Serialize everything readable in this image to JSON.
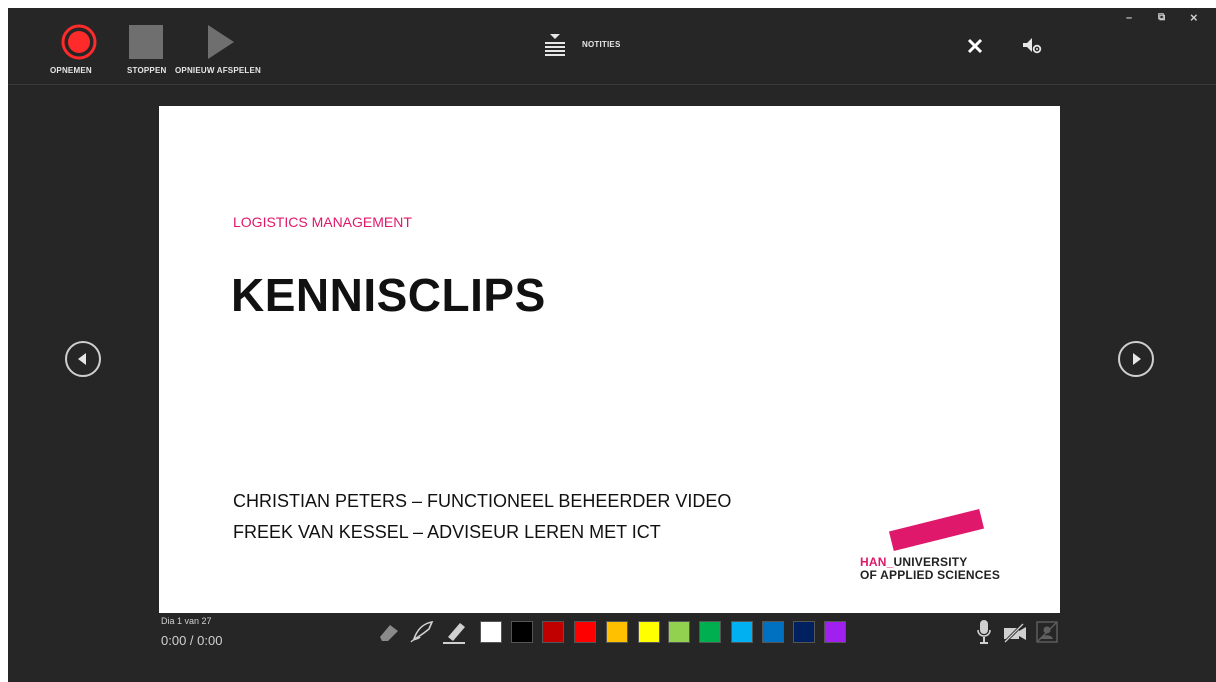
{
  "toolbar": {
    "record_label": "OPNEMEN",
    "stop_label": "STOPPEN",
    "replay_label": "OPNIEUW AFSPELEN",
    "notes_label": "NOTITIES"
  },
  "window": {
    "minimize": "–",
    "restore": "⧉",
    "close": "×"
  },
  "slide": {
    "subtitle": "LOGISTICS MANAGEMENT",
    "title": "KENNISCLIPS",
    "person1": "CHRISTIAN PETERS – FUNCTIONEEL BEHEERDER VIDEO",
    "person2": "FREEK VAN KESSEL – ADVISEUR LEREN MET ICT",
    "logo_line1_prefix": "HAN_",
    "logo_line1_rest": "UNIVERSITY",
    "logo_line2": "OF APPLIED SCIENCES"
  },
  "status": {
    "slide_counter": "Dia 1 van 27",
    "time": "0:00 / 0:00"
  },
  "pen_colors": [
    "#ffffff",
    "#000000",
    "#c00000",
    "#ff0000",
    "#ffc000",
    "#ffff00",
    "#92d050",
    "#00b050",
    "#00b0f0",
    "#0070c0",
    "#002060",
    "#a020f0"
  ],
  "icons": {
    "record": "record-icon",
    "stop": "stop-icon",
    "replay": "play-icon",
    "notes": "notes-icon",
    "close": "close-icon",
    "settings": "settings-icon",
    "prev": "previous-icon",
    "next": "next-icon",
    "eraser": "eraser-icon",
    "pen": "pen-icon",
    "highlighter": "highlighter-icon",
    "mic": "microphone-icon",
    "camera": "camera-off-icon",
    "preview": "camera-preview-off-icon"
  }
}
